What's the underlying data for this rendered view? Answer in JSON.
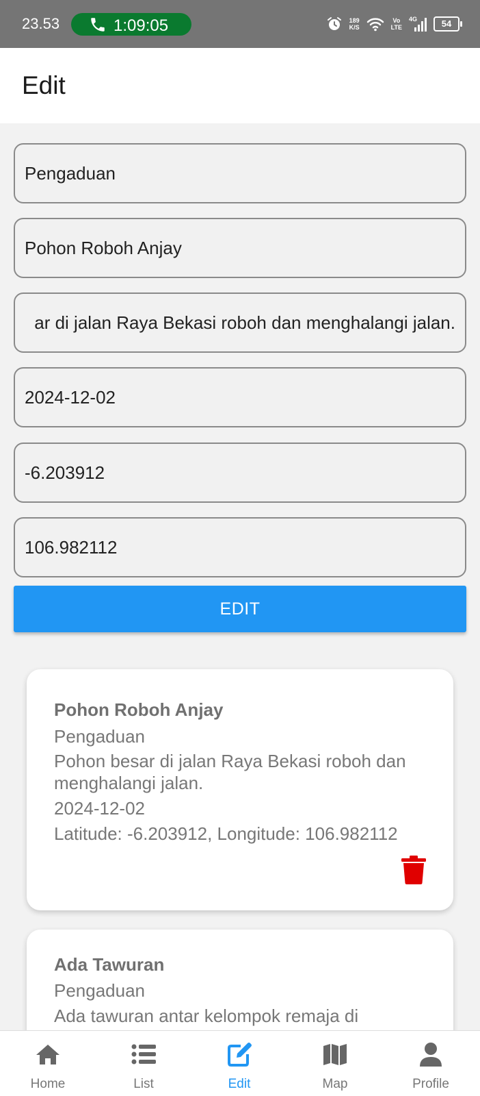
{
  "status_bar": {
    "time": "23.53",
    "call_duration": "1:09:05",
    "network_speed_top": "189",
    "network_speed_bottom": "K/S",
    "volte_top": "Vo",
    "volte_bottom": "LTE",
    "network_type": "4G",
    "battery": "54"
  },
  "appbar": {
    "title": "Edit"
  },
  "form": {
    "category": "Pengaduan",
    "title": "Pohon Roboh Anjay",
    "description_visible": "ar di jalan Raya Bekasi roboh dan menghalangi jalan.",
    "date": "2024-12-02",
    "latitude": "-6.203912",
    "longitude": "106.982112",
    "submit_label": "EDIT"
  },
  "cards": [
    {
      "title": "Pohon Roboh Anjay",
      "category": "Pengaduan",
      "description_line1": "Pohon besar di jalan Raya Bekasi roboh dan",
      "description_line2": "menghalangi jalan.",
      "date": "2024-12-02",
      "coords": "Latitude: -6.203912, Longitude: 106.982112"
    },
    {
      "title": "Ada Tawuran",
      "category": "Pengaduan",
      "description_line1": "Ada tawuran antar kelompok remaja di"
    }
  ],
  "bottom_nav": {
    "items": [
      {
        "label": "Home",
        "icon": "home-icon"
      },
      {
        "label": "List",
        "icon": "list-icon"
      },
      {
        "label": "Edit",
        "icon": "edit-icon"
      },
      {
        "label": "Map",
        "icon": "map-icon"
      },
      {
        "label": "Profile",
        "icon": "profile-icon"
      }
    ],
    "active_index": 2
  },
  "colors": {
    "accent": "#2196f3",
    "delete": "#e00000",
    "call_pill": "#0a7a2f",
    "status_bar": "#757575"
  }
}
